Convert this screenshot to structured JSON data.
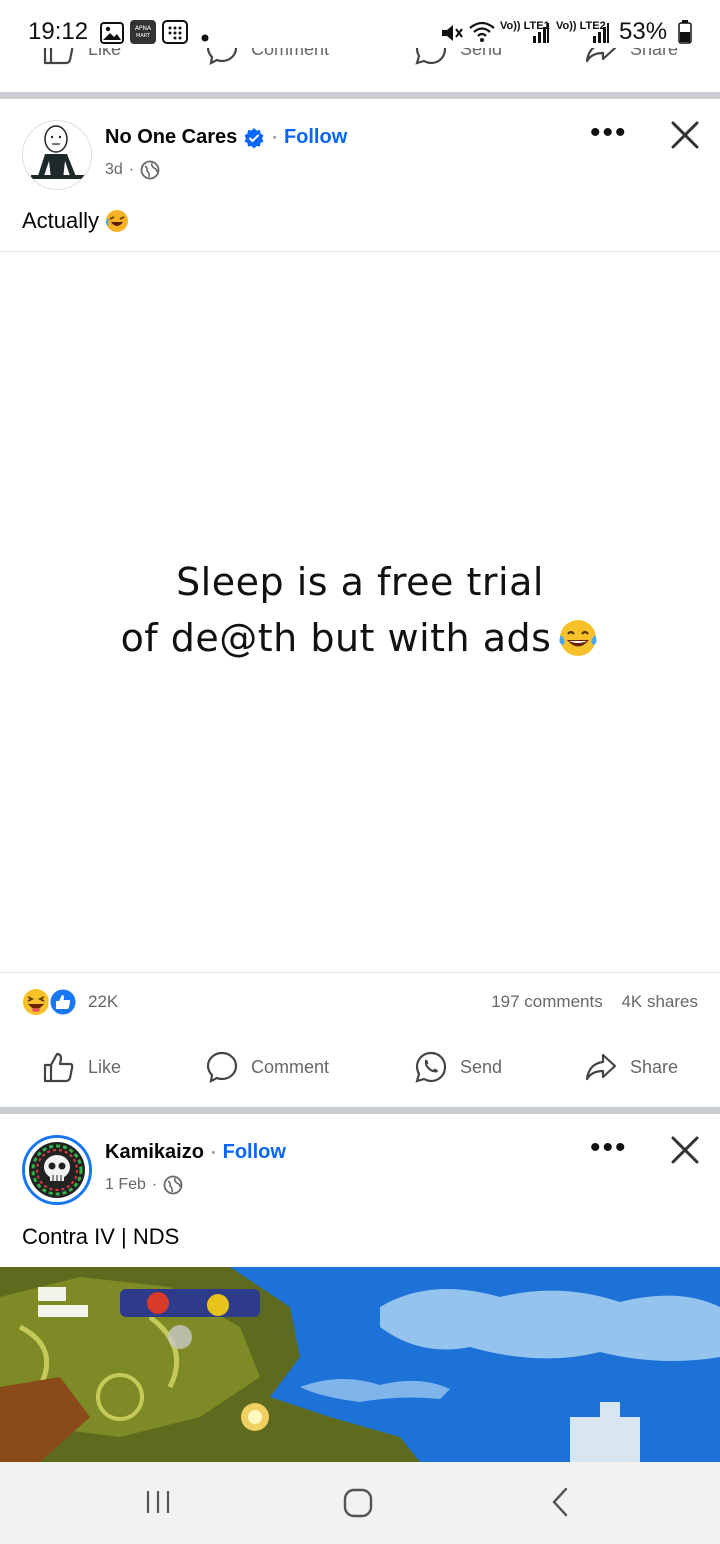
{
  "status_bar": {
    "time": "19:12",
    "battery": "53%",
    "lte1": "Vo)) LTE1",
    "lte2": "Vo)) LTE2",
    "app_badge": "APNA MART"
  },
  "prev_post_actions": {
    "like": "Like",
    "comment": "Comment",
    "send": "Send",
    "share": "Share"
  },
  "post1": {
    "author": "No One Cares",
    "verified": true,
    "follow": "Follow",
    "time": "3d",
    "caption": "Actually",
    "meme_line1": "Sleep is a free trial",
    "meme_line2": "of de@th but with ads",
    "reaction_count": "22K",
    "comments": "197 comments",
    "shares": "4K shares",
    "actions": {
      "like": "Like",
      "comment": "Comment",
      "send": "Send",
      "share": "Share"
    }
  },
  "post2": {
    "author": "Kamikaizo",
    "follow": "Follow",
    "time": "1 Feb",
    "caption": "Contra IV | NDS"
  },
  "colors": {
    "follow_blue": "#0866ff",
    "secondary_text": "#65676b",
    "divider": "#c9ccd1"
  }
}
